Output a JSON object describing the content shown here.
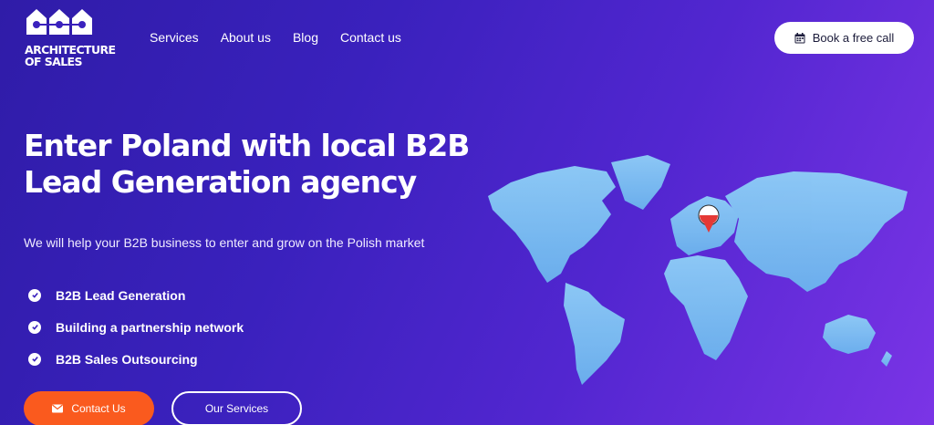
{
  "brand": {
    "name": "ARCHITECTURE\nOF SALES"
  },
  "nav": {
    "items": [
      "Services",
      "About us",
      "Blog",
      "Contact us"
    ]
  },
  "header": {
    "cta_label": "Book a free call"
  },
  "hero": {
    "title_line1": "Enter Poland with local B2B",
    "title_line2": "Lead Generation agency",
    "subtitle": "We will help your B2B business to enter and grow on the Polish market",
    "features": [
      "B2B Lead Generation",
      "Building a partnership network",
      "B2B Sales Outsourcing"
    ],
    "contact_label": "Contact Us",
    "services_label": "Our Services"
  },
  "colors": {
    "accent": "#fa5a1e",
    "map": "#7cc4f2",
    "pin": "#e53935"
  },
  "icons": [
    "calendar-icon",
    "check-circle-icon",
    "envelope-icon",
    "map-pin-icon"
  ]
}
